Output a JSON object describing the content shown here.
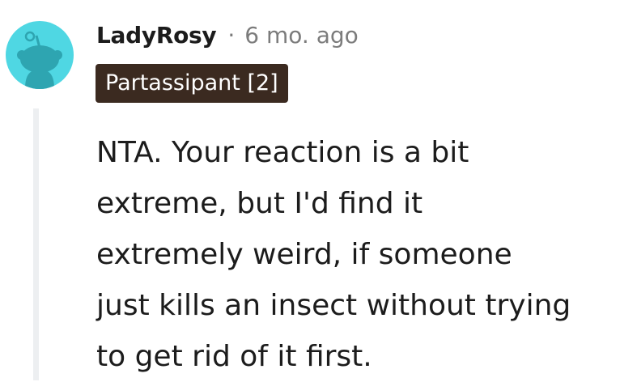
{
  "comment": {
    "author": "LadyRosy",
    "separator": "·",
    "timestamp": "6 mo. ago",
    "flair": "Partassipant [2]",
    "avatar_icon": "reddit-snoo-avatar-icon",
    "body_lines": [
      "NTA. Your reaction is a bit",
      "extreme, but I'd find it",
      "extremely weird, if someone",
      "just kills an insect without trying",
      "to get rid of it first."
    ]
  },
  "colors": {
    "avatar_background": "#4fd7e3",
    "avatar_figure": "#2ea5b1",
    "flair_background": "#3b2a20",
    "thread_line": "#edeff1",
    "meta_gray": "#7c7c7c"
  }
}
